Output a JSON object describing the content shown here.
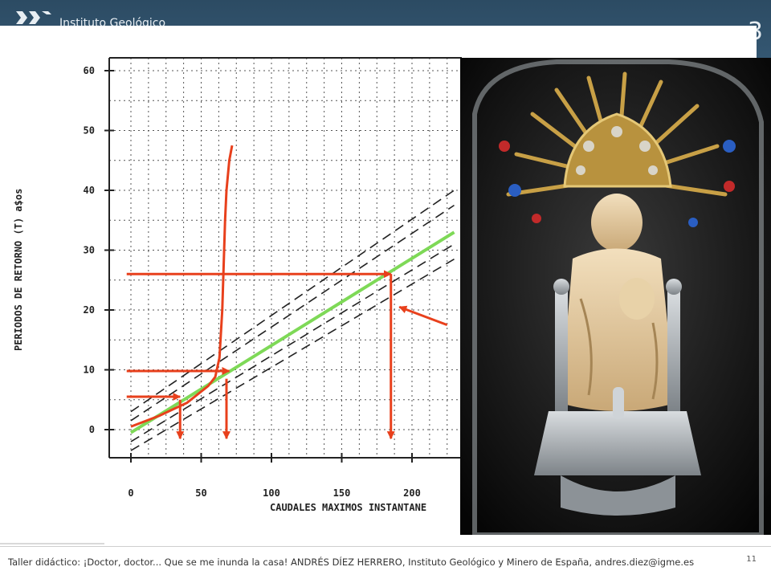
{
  "header": {
    "institute_text": "Instituto Geológico",
    "partial_mark": "3"
  },
  "chart_data": {
    "type": "line",
    "title": "",
    "xlabel": "CAUDALES MAXIMOS INSTANTANE",
    "ylabel": "PERIODOS DE RETORNO (T) a$os",
    "x_ticks": [
      0,
      50,
      100,
      150,
      200
    ],
    "y_ticks": [
      0,
      10,
      20,
      30,
      40,
      50,
      60
    ],
    "xlim": [
      0,
      230
    ],
    "ylim": [
      0,
      60
    ],
    "grid": true,
    "series": [
      {
        "x": [
          0,
          230
        ],
        "y": [
          -0.5,
          33
        ],
        "color": "#7ed957"
      },
      {
        "x": [
          0,
          230
        ],
        "y": [
          1.5,
          37.5
        ],
        "color": "#222222"
      },
      {
        "x": [
          0,
          230
        ],
        "y": [
          -2,
          31
        ],
        "color": "#222222"
      },
      {
        "x": [
          0,
          230
        ],
        "y": [
          3,
          40
        ],
        "color": "#222222"
      },
      {
        "x": [
          0,
          230
        ],
        "y": [
          -3.5,
          28.5
        ],
        "color": "#222222"
      },
      {
        "x": [
          0,
          20,
          40,
          55,
          60,
          63,
          65,
          67,
          68,
          70,
          72
        ],
        "y": [
          0.5,
          2.3,
          4.5,
          7.3,
          8.8,
          12,
          20,
          35,
          40,
          45,
          47.5
        ],
        "color": "#e8401c"
      }
    ],
    "arrows": [
      {
        "from": [
          -3,
          26
        ],
        "to": [
          185,
          26
        ]
      },
      {
        "from": [
          185,
          26
        ],
        "to": [
          185,
          -1.5
        ]
      },
      {
        "from": [
          -3,
          9.8
        ],
        "to": [
          70,
          9.8
        ]
      },
      {
        "from": [
          68,
          8.5
        ],
        "to": [
          68,
          -1.5
        ]
      },
      {
        "from": [
          -3,
          5.5
        ],
        "to": [
          35,
          5.5
        ]
      },
      {
        "from": [
          35,
          5
        ],
        "to": [
          35,
          -1.5
        ]
      },
      {
        "from": [
          225,
          17.5
        ],
        "to": [
          191,
          20.5
        ]
      }
    ]
  },
  "footer": {
    "text": "Taller didáctico: ¡Doctor, doctor... Que se me inunda la casa! ANDRÉS DÍEZ HERRERO, Instituto Geológico y Minero de España, andres.diez@igme.es",
    "page": "11"
  },
  "colors": {
    "header": "#2f4f68",
    "arrow": "#e8401c",
    "fit_line": "#7ed957"
  },
  "icons": {
    "logo": "igme-logo-icon",
    "photo": "virgin-statue-photo"
  }
}
